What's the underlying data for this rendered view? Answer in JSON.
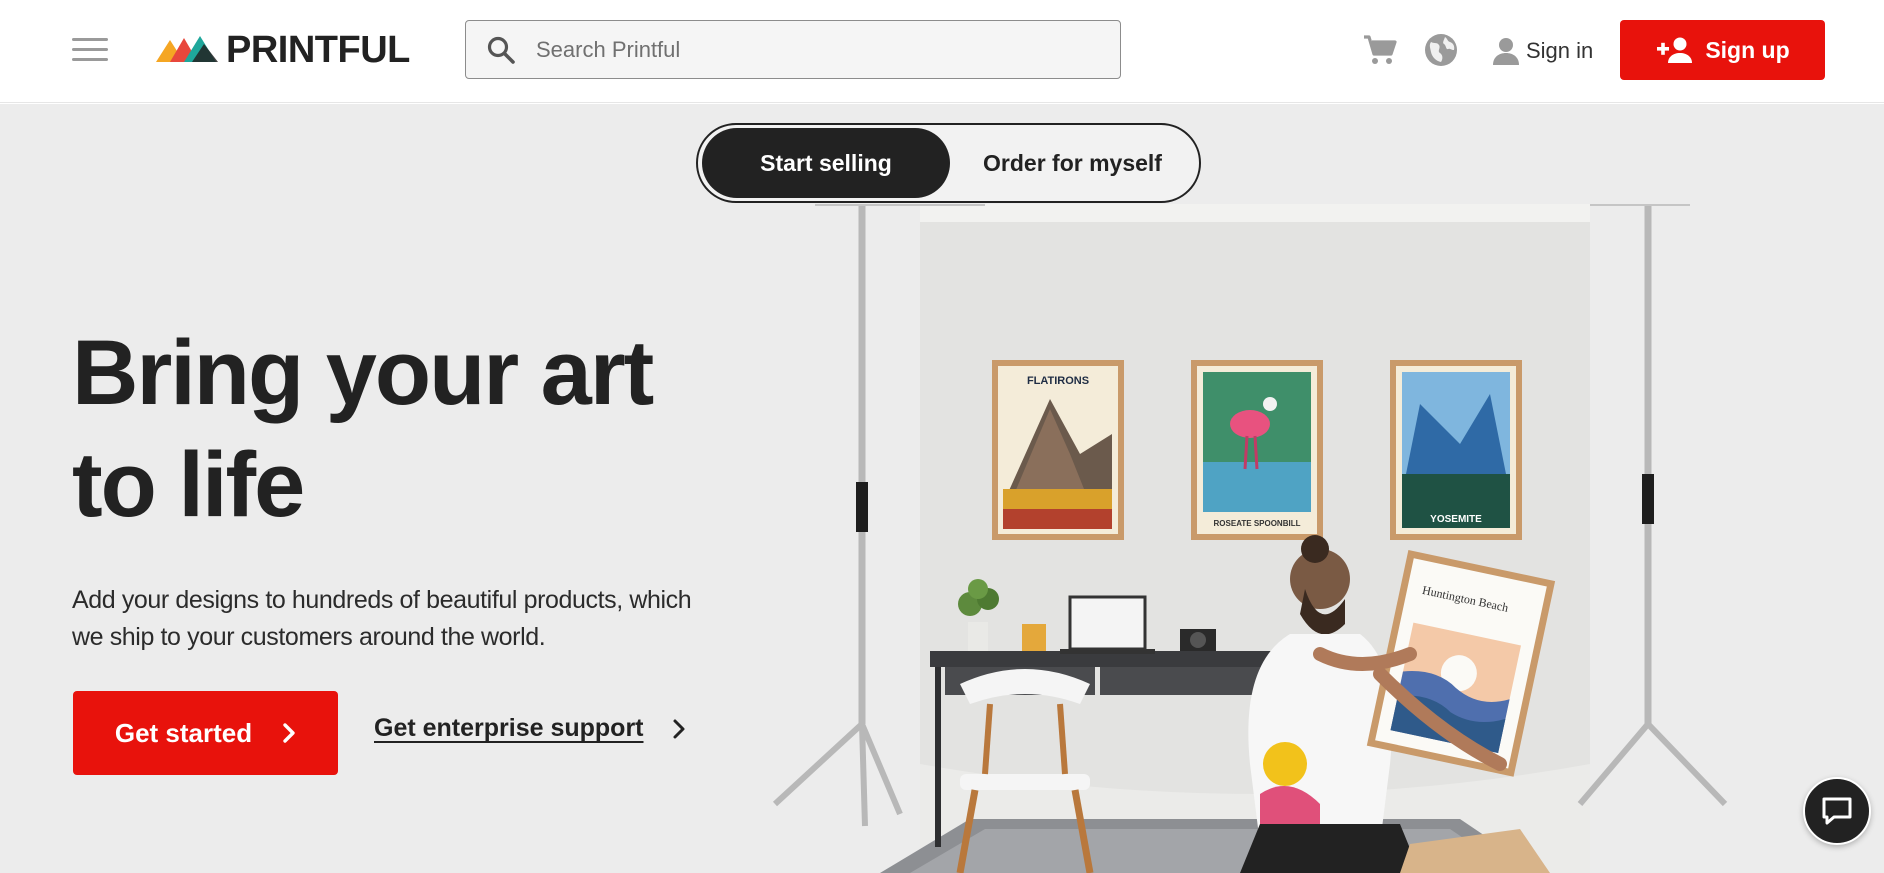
{
  "header": {
    "menu_icon": "hamburger-menu-icon",
    "logo_text": "PRINTFUL",
    "search": {
      "placeholder": "Search Printful",
      "value": "",
      "icon": "search-icon"
    },
    "cart_icon": "cart-icon",
    "language_icon": "globe-icon",
    "signin_label": "Sign in",
    "signup_label": "Sign up"
  },
  "hero": {
    "toggle": {
      "active": "Start selling",
      "other": "Order for myself"
    },
    "headline_line1": "Bring your art",
    "headline_line2": "to life",
    "subtext": "Add your designs to hundreds of beautiful products, which we ship to your customers around the world.",
    "cta_label": "Get started",
    "enterprise_label": "Get enterprise support",
    "posters": [
      {
        "title": "FLATIRONS"
      },
      {
        "title": "ROSEATE SPOONBILL"
      },
      {
        "title": "YOSEMITE"
      }
    ],
    "held_poster_title": "Huntington Beach"
  },
  "colors": {
    "brand_red": "#e8120c",
    "dark": "#222222",
    "hero_bg": "#ececec"
  },
  "chat_icon": "chat-bubble-icon"
}
